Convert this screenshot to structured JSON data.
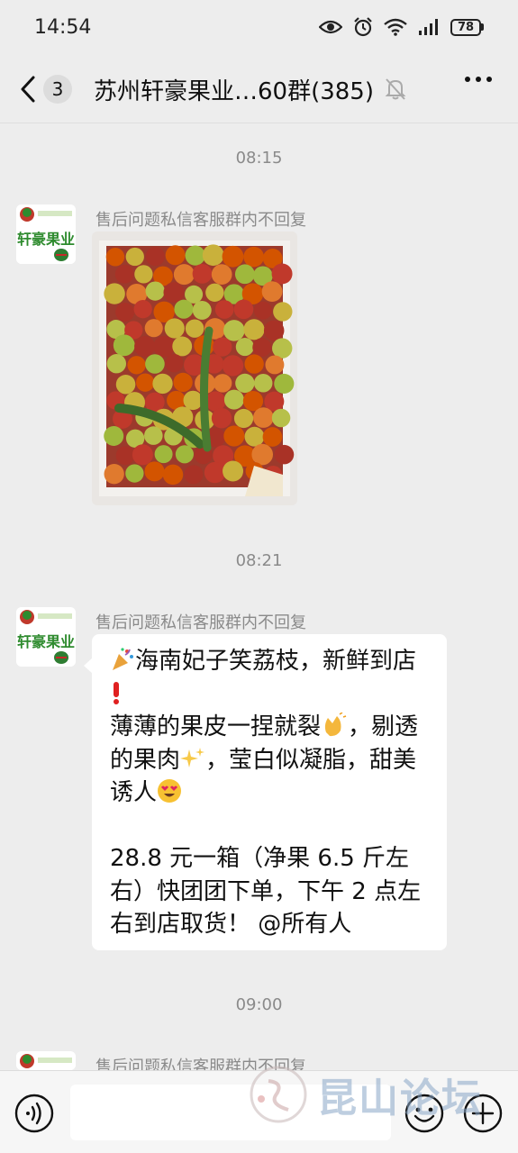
{
  "status_bar": {
    "time": "14:54",
    "battery": "78"
  },
  "header": {
    "unread_count": "3",
    "title": "苏州轩豪果业…60群(385)"
  },
  "timestamps": [
    "08:15",
    "08:21",
    "09:00"
  ],
  "messages": [
    {
      "sender": "售后问题私信客服群内不回复",
      "type": "image",
      "avatar_text": "轩豪果业"
    },
    {
      "sender": "售后问题私信客服群内不回复",
      "type": "text",
      "avatar_text": "轩豪果业",
      "line1": "海南妃子笑荔枝，新鲜到店",
      "line2": "薄薄的果皮一捏就裂",
      "line2b": "，剔透的果肉",
      "line3": "，莹白似凝脂，甜美诱人",
      "line4": "28.8 元一箱（净果 6.5 斤左右）快团团下单，下午 2 点左右到店取货！ @所有人"
    },
    {
      "sender": "售后问题私信客服群内不回复",
      "type": "partial",
      "avatar_text": "轩豪果业"
    }
  ],
  "input": {
    "placeholder": ""
  },
  "watermark": {
    "text": "昆山论坛"
  },
  "colors": {
    "background": "#ededed",
    "bubble": "#ffffff",
    "timestamp": "#8a8a8a",
    "avatar_green": "#2e8b2e"
  },
  "icons": [
    "eye-icon",
    "alarm-icon",
    "wifi-icon",
    "signal-icon",
    "battery-icon",
    "back-icon",
    "mute-bell-icon",
    "more-icon",
    "voice-icon",
    "emoji-icon",
    "plus-icon"
  ]
}
